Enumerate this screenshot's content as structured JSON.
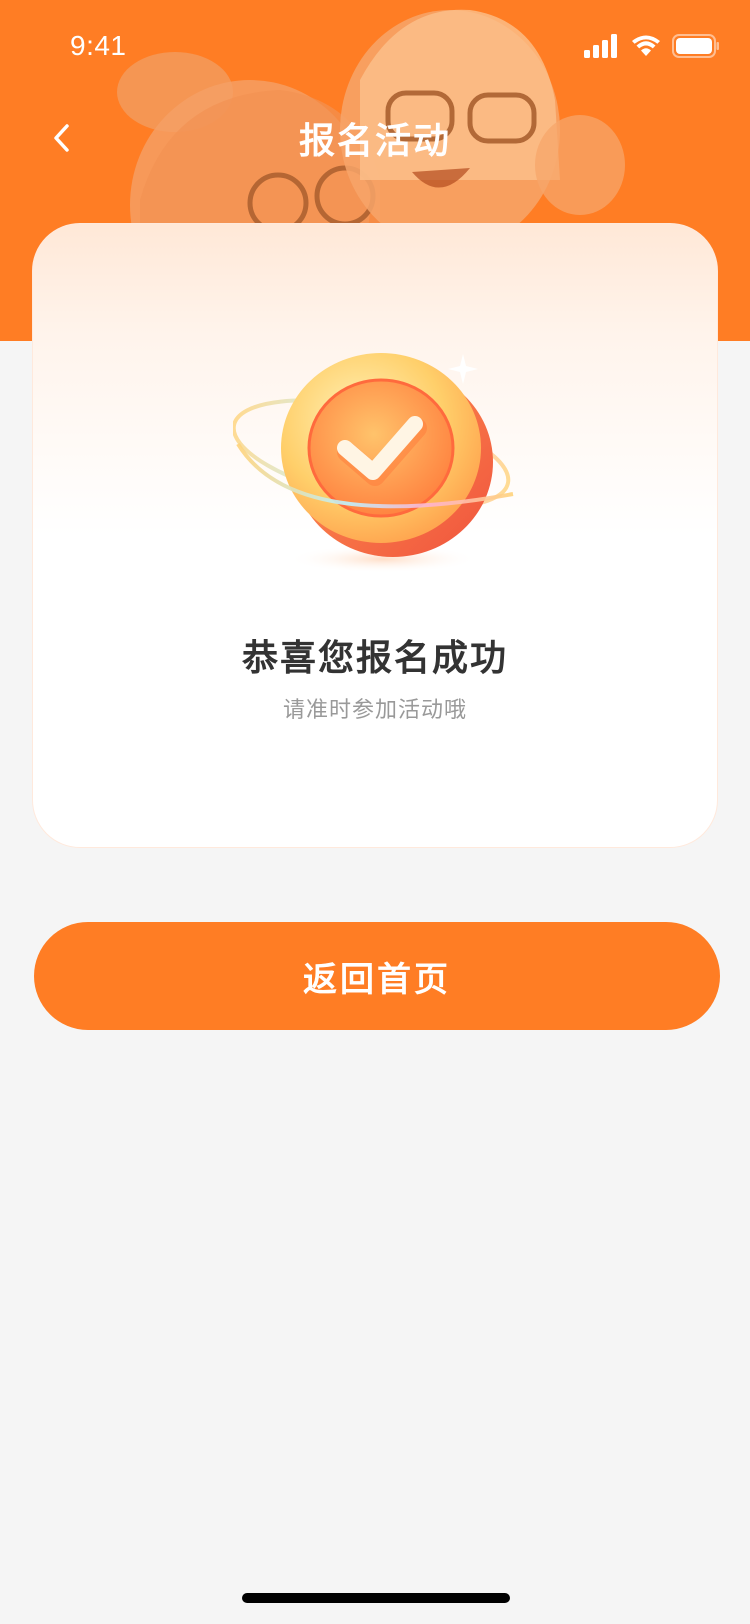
{
  "status_bar": {
    "time": "9:41"
  },
  "nav": {
    "title": "报名活动",
    "back_icon": "chevron-left-icon"
  },
  "colors": {
    "brand": "#ff7d24",
    "background": "#f5f5f5",
    "title_text": "#333333",
    "sub_text": "#999999"
  },
  "result_card": {
    "icon": "check-badge-icon",
    "title": "恭喜您报名成功",
    "subtitle": "请准时参加活动哦"
  },
  "actions": {
    "home_button_label": "返回首页"
  }
}
